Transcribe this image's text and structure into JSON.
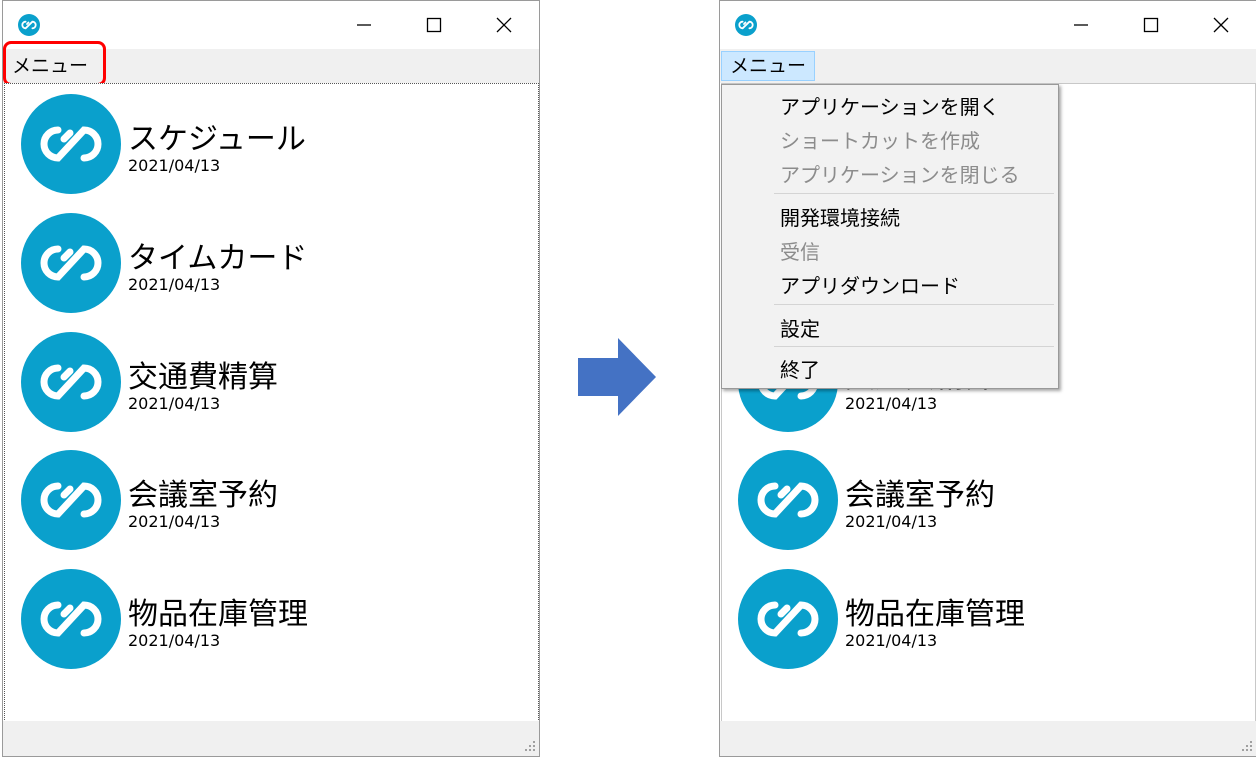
{
  "window": {
    "menu_label": "メニュー"
  },
  "apps": [
    {
      "name": "スケジュール",
      "date": "2021/04/13"
    },
    {
      "name": "タイムカード",
      "date": "2021/04/13"
    },
    {
      "name": "交通費精算",
      "date": "2021/04/13"
    },
    {
      "name": "会議室予約",
      "date": "2021/04/13"
    },
    {
      "name": "物品在庫管理",
      "date": "2021/04/13"
    }
  ],
  "dropdown": {
    "items": [
      {
        "label": "アプリケーションを開く",
        "enabled": true
      },
      {
        "label": "ショートカットを作成",
        "enabled": false
      },
      {
        "label": "アプリケーションを閉じる",
        "enabled": false
      },
      {
        "label": "開発環境接続",
        "enabled": true
      },
      {
        "label": "受信",
        "enabled": false
      },
      {
        "label": "アプリダウンロード",
        "enabled": true
      },
      {
        "label": "設定",
        "enabled": true
      },
      {
        "label": "終了",
        "enabled": true
      }
    ]
  },
  "colors": {
    "logo_blue": "#0aa0cc",
    "arrow_blue": "#4472c4",
    "highlight_red": "#ff0000",
    "menu_open_bg": "#cce8ff"
  },
  "icons": {
    "app_logo": "infinity-link-icon",
    "minimize": "minimize-icon",
    "maximize": "maximize-icon",
    "close": "close-icon",
    "arrow": "right-arrow-icon"
  }
}
